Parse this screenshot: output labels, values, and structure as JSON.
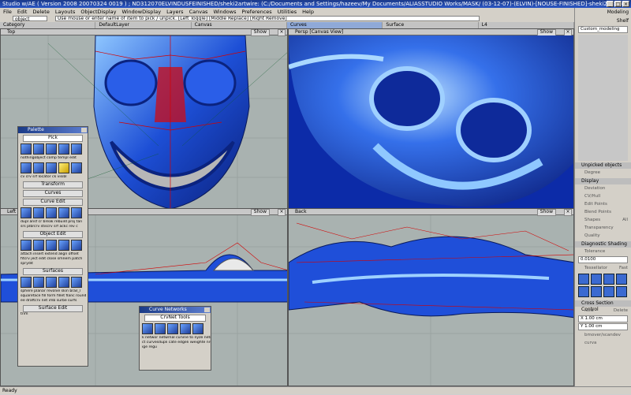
{
  "window": {
    "title": "Studio w/AE ( Version 2008   20070324 0019 ) ; ND312070ELVINDUSFEINISHED/sheki2artwire: (C:/Documents and Settings/hazeev/My Documents/ALIASSTUDIO Works/MASK/ (03-12-07)-(ELVIN)-[NOUSE-FINISHED]-sheki2art.wire"
  },
  "menu": [
    "File",
    "Edit",
    "Delete",
    "Layouts",
    "ObjectDisplay",
    "WindowDisplay",
    "Layers",
    "Canvas",
    "Windows",
    "Preferences",
    "Utilities",
    "Help"
  ],
  "command": {
    "pick_value": "object",
    "message": "Use mouse or enter name of item to pick / unpick. [Left Toggle] [Middle Replace] [Right Remove]"
  },
  "shelf_tabs": [
    "Category",
    "DefaultLayer",
    "Canvas",
    "Curves",
    "Surface",
    "L4"
  ],
  "active_shelf_tab": "Curves",
  "viewports": {
    "top": {
      "label": "Top",
      "show": "Show"
    },
    "persp": {
      "label": "Persp [Canvas View]",
      "show": "Show"
    },
    "left": {
      "label": "Left",
      "show": "Show"
    },
    "back": {
      "label": "Back",
      "show": "Show"
    }
  },
  "palette": {
    "title": "Palette",
    "pick_tab": "Pick",
    "row1_labels": "nothingobject comp templ edit",
    "row2_labels": "cv  crv srf locator ck visibl",
    "sections": [
      "Transform",
      "Curves",
      "Curve Edit",
      "Object Edit",
      "Surfaces",
      "Surface Edit"
    ],
    "curves_labels": "dupl ansf cr break rebuild proj tan",
    "curves_labels2": "srs plbrcrv stiscrv srf ackc rev c",
    "objedit_labels": "attach insert extend align offset",
    "objedit_labels2": "fitcrv ject edit close smnem patch",
    "objedit_labels3": "sprydit",
    "surf_labels": "sphere planar revolve skin brail_l",
    "surf_labels2": "squareface fill form fillet flanc round",
    "surf_labels3": "ee draftcrv net imb surbe surfs",
    "surfedit_labels": "trim"
  },
  "curve_networks": {
    "title": "Curve Networks",
    "tab": "CrvNet Tools",
    "labels1": "k networ netwrnal curvne to nyze netr",
    "labels2": "ct curvesdupli cate edgeli iweighte nrose",
    "labels3": "ige regu"
  },
  "right_panel": {
    "modeling": "Modeling",
    "shelf": "Shelf",
    "custom_modeling": "Custom_modeling",
    "unpicked": "Unpicked objects",
    "degree": "Degree",
    "display_sec": "Display",
    "deviation": "Deviation",
    "cv_hull": "CV/Hull",
    "edit_points": "Edit Points",
    "blend_points": "Blend Points",
    "shapes": "Shapes",
    "all": "All",
    "transparency": "Transparency",
    "quality": "Quality",
    "diagnostic": "Diagnostic Shading",
    "tolerance": "Tolerance",
    "tol_value": "0.0100",
    "tessellator": "Tessellator",
    "fast": "Fast",
    "cross": "Cross Section Control",
    "new": "New",
    "delete": "Delete",
    "x_val": "X 1.00 cm",
    "y_val": "Y 1.00 cm",
    "bottom_lbl": "bmover/scandev curva"
  },
  "status": "Ready",
  "colors": {
    "mask_blue": "#1f4fd9",
    "highlight": "#9ed1ff",
    "cv_red": "#d40000",
    "viewport_bg": "#a9b2b0"
  }
}
